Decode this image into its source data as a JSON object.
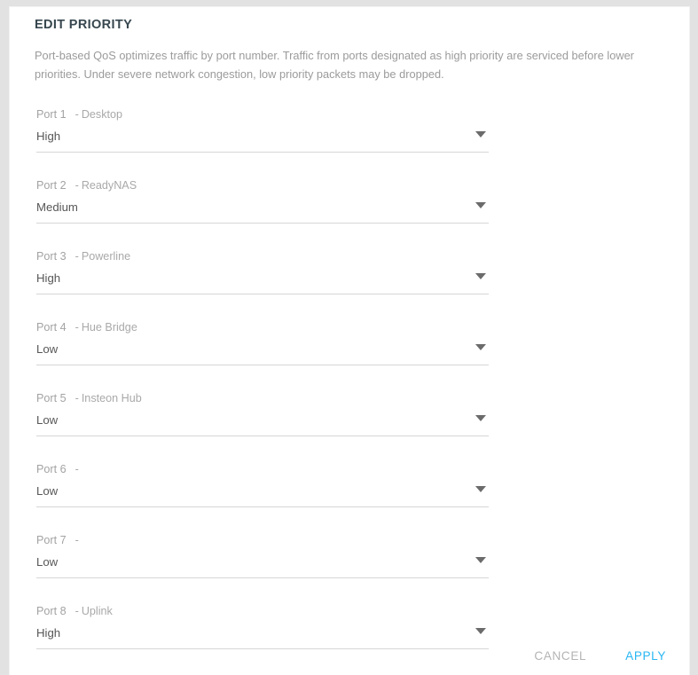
{
  "panel": {
    "title": "EDIT PRIORITY",
    "description": "Port-based QoS optimizes traffic by port number. Traffic from ports designated as high priority are serviced before lower priorities. Under severe network congestion, low priority packets may be dropped."
  },
  "separator": "-",
  "priority_options": [
    "High",
    "Medium",
    "Low"
  ],
  "ports": [
    {
      "port": "Port 1",
      "device": "Desktop",
      "priority": "High"
    },
    {
      "port": "Port 2",
      "device": "ReadyNAS",
      "priority": "Medium"
    },
    {
      "port": "Port 3",
      "device": "Powerline",
      "priority": "High"
    },
    {
      "port": "Port 4",
      "device": "Hue Bridge",
      "priority": "Low"
    },
    {
      "port": "Port 5",
      "device": "Insteon Hub",
      "priority": "Low"
    },
    {
      "port": "Port 6",
      "device": "",
      "priority": "Low"
    },
    {
      "port": "Port 7",
      "device": "",
      "priority": "Low"
    },
    {
      "port": "Port 8",
      "device": "Uplink",
      "priority": "High"
    }
  ],
  "footer": {
    "cancel_label": "CANCEL",
    "apply_label": "APPLY"
  },
  "colors": {
    "accent": "#2ab7f3",
    "title": "#37474f",
    "muted": "#a3a3a3",
    "value": "#575757",
    "underline": "#d6d6d6",
    "page_background": "#e2e2e2",
    "card_background": "#ffffff"
  },
  "icons": {
    "dropdown": "chevron-down-icon"
  }
}
